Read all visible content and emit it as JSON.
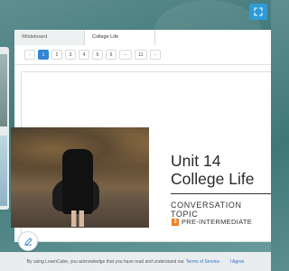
{
  "tabs": [
    {
      "label": "Whiteboard"
    },
    {
      "label": "College Life"
    }
  ],
  "pager": {
    "prev": "‹",
    "pages": [
      "1",
      "2",
      "3",
      "4",
      "5",
      "6",
      "···",
      "11"
    ],
    "next": "›",
    "current": "1"
  },
  "slide": {
    "unit": "Unit 14",
    "title": "College Life",
    "topic": "CONVERSATION TOPIC",
    "level_number": "3",
    "level_label": "PRE-INTERMEDIATE"
  },
  "cookie": {
    "text": "By using LearnCube, you acknowledge that you have read and understand our",
    "link": "Terms of Service",
    "period": ".",
    "agree": "I Agree"
  },
  "colors": {
    "accent": "#2f86d6",
    "level_badge": "#ee7d22",
    "background": "#4f8584"
  },
  "icons": {
    "fullscreen": "fullscreen-icon",
    "edit": "pencil-icon"
  }
}
